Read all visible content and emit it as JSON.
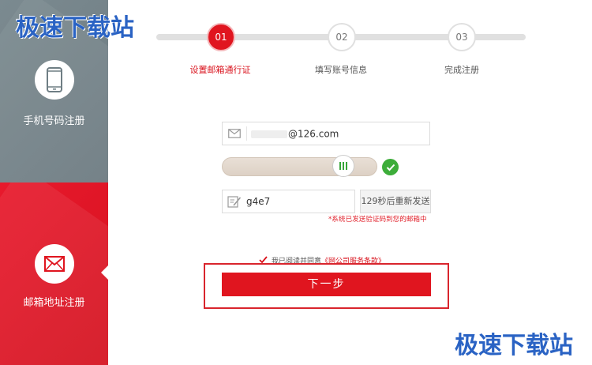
{
  "watermark": {
    "top": "极速下载站",
    "bottom": "极速下载站"
  },
  "sidebar": {
    "phone": {
      "label": "手机号码注册",
      "icon": "phone-icon"
    },
    "email": {
      "label": "邮箱地址注册",
      "icon": "envelope-icon"
    }
  },
  "steps": [
    {
      "number": "01",
      "label": "设置邮箱通行证",
      "active": true
    },
    {
      "number": "02",
      "label": "填写账号信息",
      "active": false
    },
    {
      "number": "03",
      "label": "完成注册",
      "active": false
    }
  ],
  "form": {
    "email_suffix": "@126.com",
    "slider_verified": true,
    "code_value": "g4e7",
    "resend_label": "129秒后重新发送",
    "sent_note": "*系统已发送验证码到您的邮箱中",
    "agree_prefix": "我已阅读并同意",
    "agree_terms": "《网公司服务条款》",
    "next_label": "下一步"
  },
  "colors": {
    "accent": "#e0151f",
    "sidebar_phone": "#75848a",
    "sidebar_email": "#e8192c",
    "watermark": "#2a63c4",
    "verified": "#3dad3a"
  }
}
